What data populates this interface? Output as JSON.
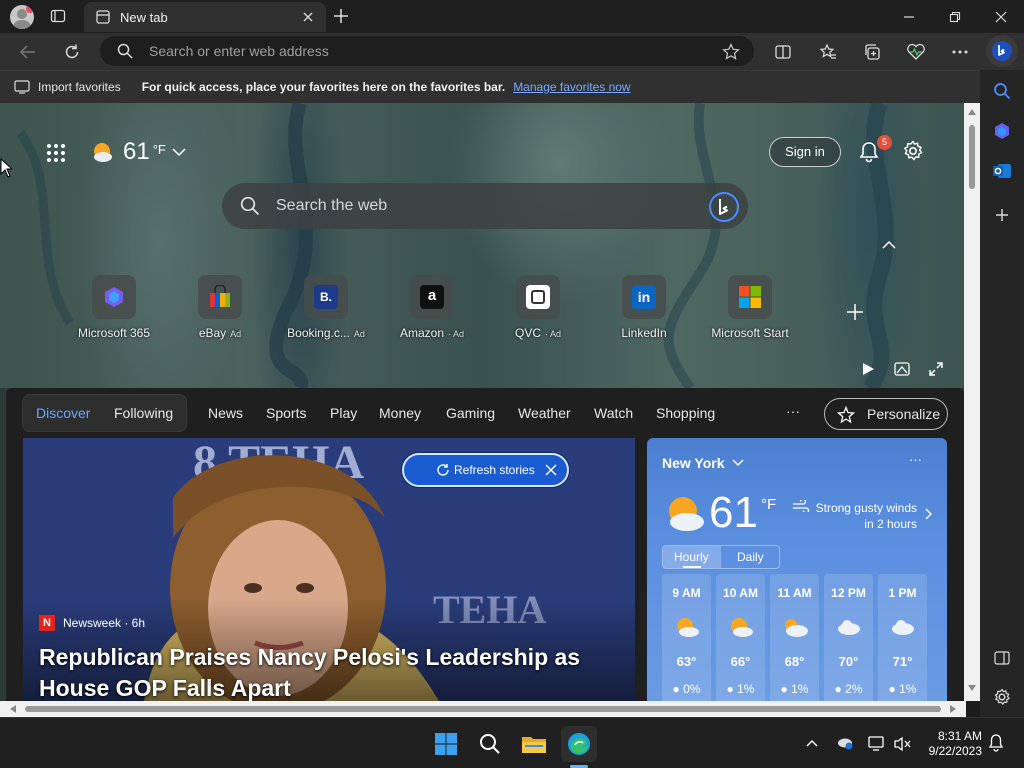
{
  "tab": {
    "title": "New tab"
  },
  "address": {
    "placeholder": "Search or enter web address"
  },
  "favorites_bar": {
    "import_label": "Import favorites",
    "hint": "For quick access, place your favorites here on the favorites bar.",
    "manage_link": "Manage favorites now"
  },
  "hero": {
    "weather_temp": "61",
    "weather_unit": "°F",
    "search_placeholder": "Search the web",
    "sign_in": "Sign in",
    "notification_count": "5"
  },
  "quick_links": [
    {
      "label": "Microsoft 365",
      "ad": ""
    },
    {
      "label": "eBay",
      "ad": "Ad"
    },
    {
      "label": "Booking.c...",
      "ad": "Ad"
    },
    {
      "label": "Amazon",
      "ad": "· Ad"
    },
    {
      "label": "QVC",
      "ad": "· Ad"
    },
    {
      "label": "LinkedIn",
      "ad": ""
    },
    {
      "label": "Microsoft Start",
      "ad": ""
    }
  ],
  "feed_nav": {
    "discover": "Discover",
    "following": "Following",
    "items": [
      "News",
      "Sports",
      "Play",
      "Money",
      "Gaming",
      "Weather",
      "Watch",
      "Shopping"
    ],
    "more": "···",
    "personalize": "Personalize"
  },
  "story": {
    "refresh": "Refresh stories",
    "source": "Newsweek · 6h",
    "headline_line1": "Republican Praises Nancy Pelosi's Leadership as",
    "headline_line2": "House GOP Falls Apart"
  },
  "weather_card": {
    "location": "New York",
    "more": "···",
    "temp": "61",
    "unit": "°F",
    "alert_line1": "Strong gusty winds",
    "alert_line2": "in 2 hours",
    "tab_hourly": "Hourly",
    "tab_daily": "Daily",
    "hours": [
      {
        "time": "9 AM",
        "temp": "63°",
        "precip": "0%"
      },
      {
        "time": "10 AM",
        "temp": "66°",
        "precip": "1%"
      },
      {
        "time": "11 AM",
        "temp": "68°",
        "precip": "1%"
      },
      {
        "time": "12 PM",
        "temp": "70°",
        "precip": "2%"
      },
      {
        "time": "1 PM",
        "temp": "71°",
        "precip": "1%"
      }
    ]
  },
  "taskbar": {
    "time": "8:31 AM",
    "date": "9/22/2023"
  }
}
